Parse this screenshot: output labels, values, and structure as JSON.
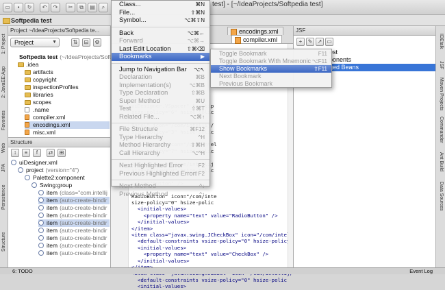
{
  "window": {
    "title": "test] - [~/IdeaProjects/Softpedia test]"
  },
  "toolbar": {
    "buttons": [
      "folder-open-icon",
      "save-icon",
      "sync-icon",
      "undo-icon",
      "redo-icon",
      "cut-icon",
      "copy-icon",
      "paste-icon",
      "find-icon",
      "replace-icon",
      "back-icon",
      "forward-icon"
    ]
  },
  "breadcrumb": {
    "project": "Softpedia test"
  },
  "left_tabs": [
    "1: Project",
    "2: JavaEE:App",
    "Favorites",
    "Web",
    "JPA",
    "Persistence",
    "Structure"
  ],
  "right_tabs": [
    "IDEtalk",
    "JSF",
    "Maven Projects",
    "Commander",
    "Ant Build",
    "Data Sources"
  ],
  "project_panel": {
    "header": "Project ~/IdeaProjects/Softpedia te...",
    "view_select": "Project",
    "tree": [
      {
        "label": "Softpedia test",
        "extra": "(~/IdeaProjects/Softpe",
        "icon": "module",
        "depth": 0
      },
      {
        "label": ".idea",
        "icon": "folder",
        "depth": 1
      },
      {
        "label": "artifacts",
        "icon": "folder",
        "depth": 2
      },
      {
        "label": "copyright",
        "icon": "folder",
        "depth": 2
      },
      {
        "label": "inspectionProfiles",
        "icon": "folder",
        "depth": 2
      },
      {
        "label": "libraries",
        "icon": "folder",
        "depth": 2
      },
      {
        "label": "scopes",
        "icon": "folder",
        "depth": 2
      },
      {
        "label": ".name",
        "icon": "file",
        "depth": 2
      },
      {
        "label": "compiler.xml",
        "icon": "xml",
        "depth": 2
      },
      {
        "label": "encodings.xml",
        "icon": "xml",
        "depth": 2,
        "selected": true
      },
      {
        "label": "misc.xml",
        "icon": "xml",
        "depth": 2
      }
    ]
  },
  "structure_panel": {
    "header": "Structure",
    "tree": [
      {
        "label": "uiDesigner.xml",
        "depth": 0
      },
      {
        "label": "project",
        "extra": "(version=\"4\")",
        "depth": 1
      },
      {
        "label": "Palette2:component",
        "depth": 2
      },
      {
        "label": "Swing:group",
        "depth": 3
      },
      {
        "label": "item",
        "extra": "(class=\"com.intellij",
        "depth": 4
      },
      {
        "label": "item",
        "extra": "(auto-create-bindir",
        "depth": 4,
        "selected": true
      },
      {
        "label": "item",
        "extra": "(auto-create-bindir",
        "depth": 4
      },
      {
        "label": "item",
        "extra": "(auto-create-bindir",
        "depth": 4
      },
      {
        "label": "item",
        "extra": "(auto-create-bindir",
        "depth": 4,
        "selected": true
      },
      {
        "label": "item",
        "extra": "(auto-create-bindir",
        "depth": 4
      },
      {
        "label": "item",
        "extra": "(auto-create-bindir",
        "depth": 4
      },
      {
        "label": "item",
        "extra": "(auto-create-bindir",
        "depth": 4
      },
      {
        "label": "item",
        "extra": "(auto-create-bindir",
        "depth": 4
      }
    ]
  },
  "editor": {
    "tabs": [
      {
        "label": "encodings.xml",
        "active": false
      },
      {
        "label": "compiler.xml",
        "active": true
      }
    ],
    "code_lines": [
      "uiDesigner.VSpacer\" tooltip",
      "size-policy=\"6\" hsize-polic",
      "",
      "Panel\" icon=\"/com/intellij/",
      "size-policy=\"3\" hsize-polic",
      "",
      "ScrollPane\" icon=\"/com/intel",
      "size-policy=\"7\" hsize-polic",
      "",
      "Button\" icon=\"/com/intellij",
      "size-policy=\"0\" hsize-polic",
      "",
      "value=\"Button\" />",
      "",
      "RadioButton\" icon=\"/com/inte",
      "size-policy=\"0\" hsize-polic",
      "  <initial-values>",
      "    <property name=\"text\" value=\"RadioButton\" />",
      "  </initial-values>",
      "</item>",
      "<item class=\"javax.swing.JCheckBox\" icon=\"/com/intell",
      "  <default-constraints vsize-policy=\"0\" hsize-policy",
      "  <initial-values>",
      "    <property name=\"text\" value=\"CheckBox\" />",
      "  </initial-values>",
      "</item>",
      "<item class=\"javax.swing.JLabel\" icon=\"/com/intellij/",
      "  <default-constraints vsize-policy=\"0\" hsize-polic",
      "  <initial-values>"
    ]
  },
  "jsf_panel": {
    "header": "JSF",
    "rows": [
      {
        "label": "est",
        "selected": false
      },
      {
        "label": "ponents",
        "selected": false
      },
      {
        "label": "ged Beans",
        "selected": true
      }
    ]
  },
  "navigate_menu": {
    "items": [
      {
        "label": "Class...",
        "shortcut": "⌘N",
        "disabled": false
      },
      {
        "label": "File...",
        "shortcut": "⇧⌘N",
        "disabled": false
      },
      {
        "label": "Symbol...",
        "shortcut": "⌥⌘⇧N",
        "disabled": false
      },
      {
        "sep": true
      },
      {
        "label": "Back",
        "shortcut": "⌥⌘←",
        "disabled": false
      },
      {
        "label": "Forward",
        "shortcut": "⌥⌘→",
        "disabled": true
      },
      {
        "label": "Last Edit Location",
        "shortcut": "⇧⌘⌫",
        "disabled": false
      },
      {
        "label": "Bookmarks",
        "shortcut": "▶",
        "disabled": false,
        "highlighted": true
      },
      {
        "sep": true
      },
      {
        "label": "Jump to Navigation Bar",
        "shortcut": "⌥↖",
        "disabled": false
      },
      {
        "label": "Declaration",
        "shortcut": "⌘B",
        "disabled": true
      },
      {
        "label": "Implementation(s)",
        "shortcut": "⌥⌘B",
        "disabled": true
      },
      {
        "label": "Type Declaration",
        "shortcut": "⇧⌘B",
        "disabled": true
      },
      {
        "label": "Super Method",
        "shortcut": "⌘U",
        "disabled": true
      },
      {
        "label": "Test",
        "shortcut": "⇧⌘T",
        "disabled": true
      },
      {
        "label": "Related File...",
        "shortcut": "⌥⌘↑",
        "disabled": true
      },
      {
        "sep": true
      },
      {
        "label": "File Structure",
        "shortcut": "⌘F12",
        "disabled": true
      },
      {
        "label": "Type Hierarchy",
        "shortcut": "^H",
        "disabled": true
      },
      {
        "label": "Method Hierarchy",
        "shortcut": "⇧⌘H",
        "disabled": true
      },
      {
        "label": "Call Hierarchy",
        "shortcut": "⌥^H",
        "disabled": true
      },
      {
        "sep": true
      },
      {
        "label": "Next Highlighted Error",
        "shortcut": "F2",
        "disabled": true
      },
      {
        "label": "Previous Highlighted Error",
        "shortcut": "⇧F2",
        "disabled": true
      },
      {
        "sep": true
      },
      {
        "label": "Next Method",
        "shortcut": "^↓",
        "disabled": true
      },
      {
        "label": "Previous Method",
        "shortcut": "^↑",
        "disabled": true
      }
    ]
  },
  "bookmarks_submenu": {
    "items": [
      {
        "label": "Toggle Bookmark",
        "shortcut": "F11",
        "disabled": true
      },
      {
        "label": "Toggle Bookmark With Mnemonic",
        "shortcut": "⌥F11",
        "disabled": true
      },
      {
        "label": "Show Bookmarks",
        "shortcut": "⇧F11",
        "disabled": false,
        "highlighted": true
      },
      {
        "label": "Next Bookmark",
        "shortcut": "",
        "disabled": true
      },
      {
        "label": "Previous Bookmark",
        "shortcut": "",
        "disabled": true
      }
    ]
  },
  "statusbar": {
    "todo": "6: TODO",
    "event_log": "Event Log"
  },
  "colors": {
    "menu_highlight": "#3a66c4",
    "selection": "#3875d7",
    "folder": "#e6bd52"
  }
}
